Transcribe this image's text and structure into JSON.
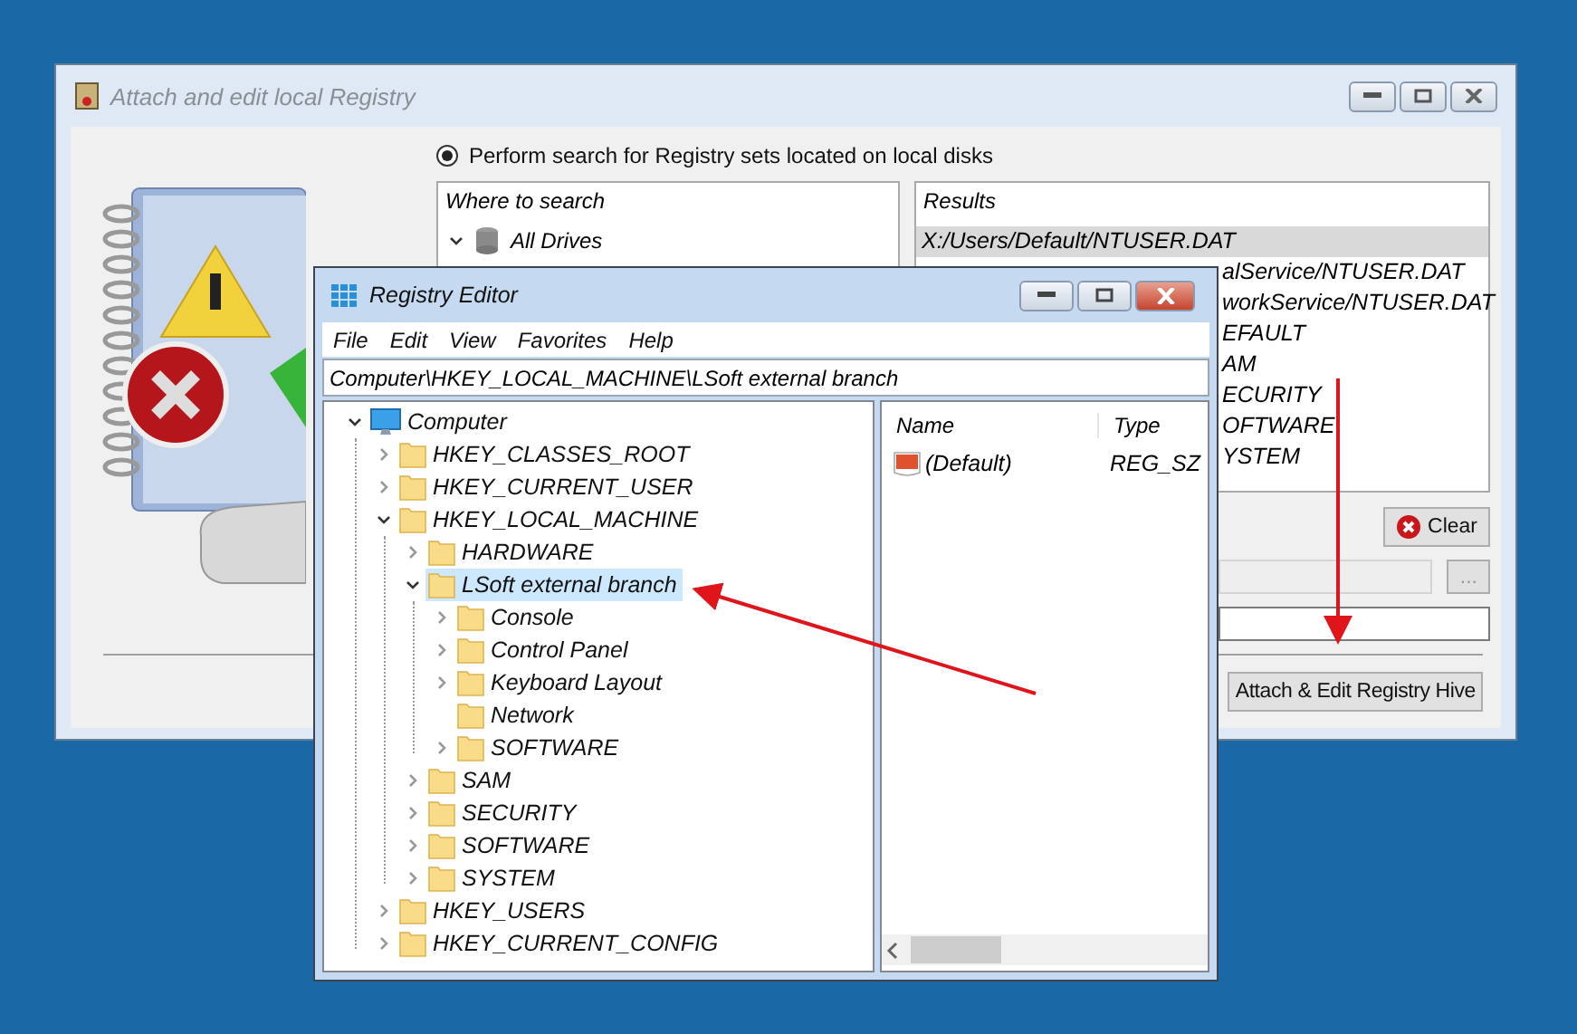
{
  "back_window": {
    "title": "Attach and edit local Registry",
    "search_option": {
      "label": "Perform search for Registry sets located on local disks",
      "selected": true
    },
    "where_to_search": {
      "header": "Where to search",
      "items": [
        {
          "label": "All Drives",
          "expanded": true
        }
      ]
    },
    "results": {
      "header": "Results",
      "rows": [
        {
          "text": "X:/Users/Default/NTUSER.DAT",
          "selected": true,
          "kind": "full"
        },
        {
          "text": "alService/NTUSER.DAT",
          "selected": false,
          "kind": "clipped"
        },
        {
          "text": "workService/NTUSER.DAT",
          "selected": false,
          "kind": "clipped"
        },
        {
          "text": "EFAULT",
          "selected": false,
          "kind": "clipped"
        },
        {
          "text": "AM",
          "selected": false,
          "kind": "clipped"
        },
        {
          "text": "ECURITY",
          "selected": false,
          "kind": "clipped"
        },
        {
          "text": "OFTWARE",
          "selected": false,
          "kind": "clipped"
        },
        {
          "text": "YSTEM",
          "selected": false,
          "kind": "clipped"
        }
      ]
    },
    "clear_button": "Clear",
    "path_field": {
      "disabled": true
    },
    "browse_button": {
      "label": "...",
      "disabled": true
    },
    "attach_button": "Attach & Edit Registry Hive"
  },
  "registry_editor": {
    "title": "Registry Editor",
    "menu": [
      "File",
      "Edit",
      "View",
      "Favorites",
      "Help"
    ],
    "address": "Computer\\HKEY_LOCAL_MACHINE\\LSoft external branch",
    "tree": [
      {
        "label": "Computer",
        "kind": "computer",
        "expanded": true,
        "has_children": true,
        "selected": false,
        "children": [
          {
            "label": "HKEY_CLASSES_ROOT",
            "kind": "folder",
            "expanded": false,
            "has_children": true,
            "selected": false
          },
          {
            "label": "HKEY_CURRENT_USER",
            "kind": "folder",
            "expanded": false,
            "has_children": true,
            "selected": false
          },
          {
            "label": "HKEY_LOCAL_MACHINE",
            "kind": "folder",
            "expanded": true,
            "has_children": true,
            "selected": false,
            "children": [
              {
                "label": "HARDWARE",
                "kind": "folder",
                "expanded": false,
                "has_children": true,
                "selected": false
              },
              {
                "label": "LSoft external branch",
                "kind": "folder",
                "expanded": true,
                "has_children": true,
                "selected": true,
                "children": [
                  {
                    "label": "Console",
                    "kind": "folder",
                    "expanded": false,
                    "has_children": true,
                    "selected": false
                  },
                  {
                    "label": "Control Panel",
                    "kind": "folder",
                    "expanded": false,
                    "has_children": true,
                    "selected": false
                  },
                  {
                    "label": "Keyboard Layout",
                    "kind": "folder",
                    "expanded": false,
                    "has_children": true,
                    "selected": false
                  },
                  {
                    "label": "Network",
                    "kind": "folder",
                    "expanded": false,
                    "has_children": false,
                    "selected": false
                  },
                  {
                    "label": "SOFTWARE",
                    "kind": "folder",
                    "expanded": false,
                    "has_children": true,
                    "selected": false
                  }
                ]
              },
              {
                "label": "SAM",
                "kind": "folder",
                "expanded": false,
                "has_children": true,
                "selected": false
              },
              {
                "label": "SECURITY",
                "kind": "folder",
                "expanded": false,
                "has_children": true,
                "selected": false
              },
              {
                "label": "SOFTWARE",
                "kind": "folder",
                "expanded": false,
                "has_children": true,
                "selected": false
              },
              {
                "label": "SYSTEM",
                "kind": "folder",
                "expanded": false,
                "has_children": true,
                "selected": false
              }
            ]
          },
          {
            "label": "HKEY_USERS",
            "kind": "folder",
            "expanded": false,
            "has_children": true,
            "selected": false
          },
          {
            "label": "HKEY_CURRENT_CONFIG",
            "kind": "folder",
            "expanded": false,
            "has_children": true,
            "selected": false
          }
        ]
      }
    ],
    "columns": [
      "Name",
      "Type"
    ],
    "values": [
      {
        "name": "(Default)",
        "type": "REG_SZ"
      }
    ]
  }
}
